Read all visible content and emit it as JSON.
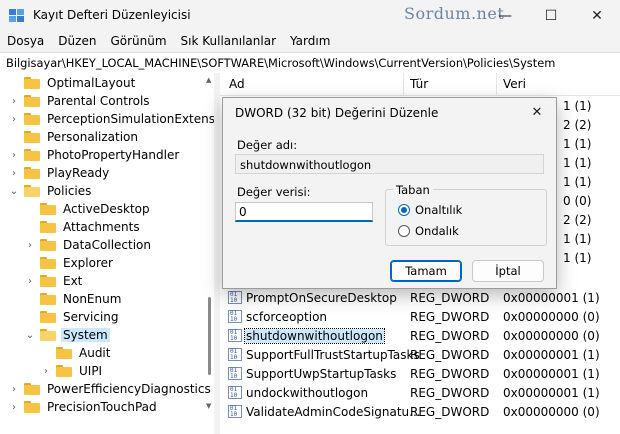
{
  "window": {
    "title": "Kayıt Defteri Düzenleyicisi",
    "watermark": "Sordum.net",
    "controls": {
      "minimize": "—",
      "maximize": "☐",
      "close": "✕"
    }
  },
  "menu": [
    {
      "label": "Dosya"
    },
    {
      "label": "Düzen"
    },
    {
      "label": "Görünüm"
    },
    {
      "label": "Sık Kullanılanlar"
    },
    {
      "label": "Yardım"
    }
  ],
  "address": "Bilgisayar\\HKEY_LOCAL_MACHINE\\SOFTWARE\\Microsoft\\Windows\\CurrentVersion\\Policies\\System",
  "tree": [
    {
      "label": "OptimalLayout",
      "chevron": "",
      "level": 1
    },
    {
      "label": "Parental Controls",
      "chevron": "›",
      "level": 1
    },
    {
      "label": "PerceptionSimulationExtensio",
      "chevron": "›",
      "level": 1
    },
    {
      "label": "Personalization",
      "chevron": "",
      "level": 1
    },
    {
      "label": "PhotoPropertyHandler",
      "chevron": "›",
      "level": 1
    },
    {
      "label": "PlayReady",
      "chevron": "›",
      "level": 1
    },
    {
      "label": "Policies",
      "chevron": "⌄",
      "level": 1
    },
    {
      "label": "ActiveDesktop",
      "chevron": "",
      "level": 2
    },
    {
      "label": "Attachments",
      "chevron": "",
      "level": 2
    },
    {
      "label": "DataCollection",
      "chevron": "›",
      "level": 2
    },
    {
      "label": "Explorer",
      "chevron": "",
      "level": 2
    },
    {
      "label": "Ext",
      "chevron": "›",
      "level": 2
    },
    {
      "label": "NonEnum",
      "chevron": "",
      "level": 2
    },
    {
      "label": "Servicing",
      "chevron": "",
      "level": 2
    },
    {
      "label": "System",
      "chevron": "⌄",
      "level": 2,
      "selected": true
    },
    {
      "label": "Audit",
      "chevron": "",
      "level": 3
    },
    {
      "label": "UIPI",
      "chevron": "›",
      "level": 3
    },
    {
      "label": "PowerEfficiencyDiagnostics",
      "chevron": "›",
      "level": 1
    },
    {
      "label": "PrecisionTouchPad",
      "chevron": "›",
      "level": 1
    }
  ],
  "list": {
    "headers": {
      "name": "Ad",
      "type": "Tür",
      "data": "Veri"
    },
    "peek_values": [
      "1 (1)",
      "2 (2)",
      "1 (1)",
      "1 (1)",
      "1 (1)",
      "0 (0)",
      "2 (2)",
      "1 (1)",
      "1 (1)"
    ],
    "rows": [
      {
        "name": "PromptOnSecureDesktop",
        "type": "REG_DWORD",
        "data": "0x00000001 (1)"
      },
      {
        "name": "scforceoption",
        "type": "REG_DWORD",
        "data": "0x00000000 (0)"
      },
      {
        "name": "shutdownwithoutlogon",
        "type": "REG_DWORD",
        "data": "0x00000000 (0)",
        "selected": true
      },
      {
        "name": "SupportFullTrustStartupTasks",
        "type": "REG_DWORD",
        "data": "0x00000001 (1)"
      },
      {
        "name": "SupportUwpStartupTasks",
        "type": "REG_DWORD",
        "data": "0x00000001 (1)"
      },
      {
        "name": "undockwithoutlogon",
        "type": "REG_DWORD",
        "data": "0x00000001 (1)"
      },
      {
        "name": "ValidateAdminCodeSignatu...",
        "type": "REG_DWORD",
        "data": "0x00000000 (0)"
      }
    ]
  },
  "dialog": {
    "title": "DWORD (32 bit) Değerini Düzenle",
    "close": "✕",
    "name_label": "Değer adı:",
    "name_value": "shutdownwithoutlogon",
    "data_label": "Değer verisi:",
    "data_value": "0",
    "base_label": "Taban",
    "hex_label": "Onaltılık",
    "dec_label": "Ondalık",
    "selected_base": "Onaltılık",
    "ok": "Tamam",
    "cancel": "İptal"
  },
  "colors": {
    "accent": "#0067c0",
    "selection": "#cce8ff",
    "folder": "#f5c443"
  }
}
